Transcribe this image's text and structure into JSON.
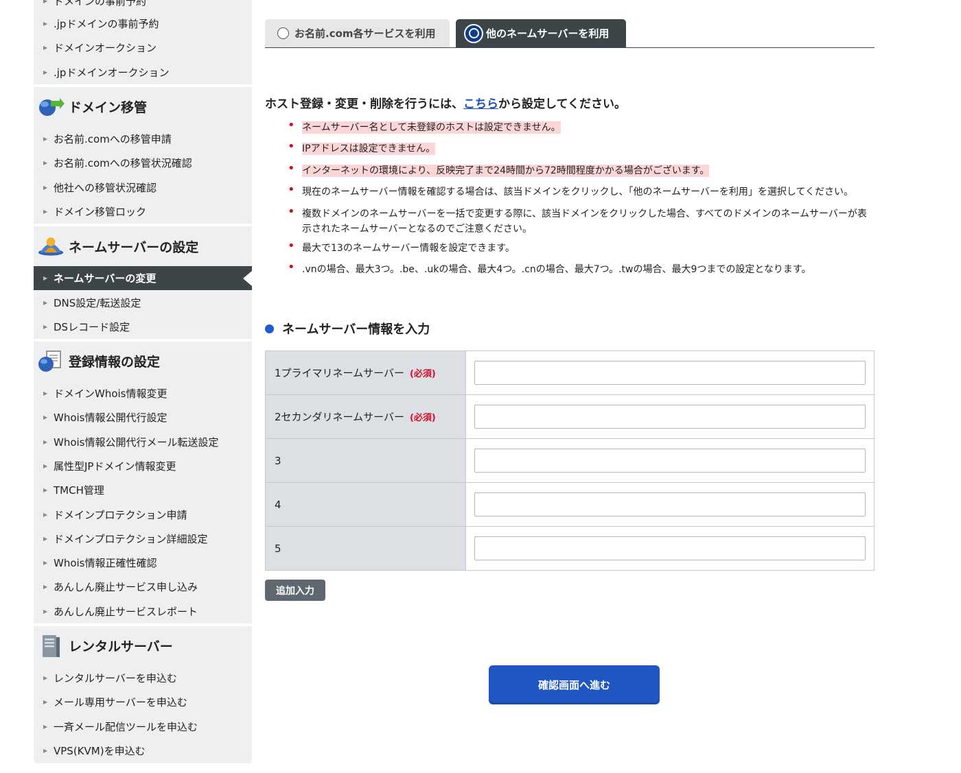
{
  "sidebar": {
    "partial_item": "ドメインの事前予約",
    "group_domain_reservation": [
      ".jpドメインの事前予約",
      "ドメインオークション",
      ".jpドメインオークション"
    ],
    "transfer": {
      "heading": "ドメイン移管",
      "items": [
        "お名前.comへの移管申請",
        "お名前.comへの移管状況確認",
        "他社への移管状況確認",
        "ドメイン移管ロック"
      ]
    },
    "nameserver": {
      "heading": "ネームサーバーの設定",
      "items": [
        "ネームサーバーの変更",
        "DNS設定/転送設定",
        "DSレコード設定"
      ]
    },
    "registration": {
      "heading": "登録情報の設定",
      "items": [
        "ドメインWhois情報変更",
        "Whois情報公開代行設定",
        "Whois情報公開代行メール転送設定",
        "属性型JPドメイン情報変更",
        "TMCH管理",
        "ドメインプロテクション申請",
        "ドメインプロテクション詳細設定",
        "Whois情報正確性確認",
        "あんしん廃止サービス申し込み",
        "あんしん廃止サービスレポート"
      ]
    },
    "rental": {
      "heading": "レンタルサーバー",
      "items": [
        "レンタルサーバーを申込む",
        "メール専用サーバーを申込む",
        "一斉メール配信ツールを申込む",
        "VPS(KVM)を申込む"
      ]
    }
  },
  "tabs": {
    "onamae": "お名前.com各サービスを利用",
    "other": "他のネームサーバーを利用"
  },
  "intro": {
    "before": "ホスト登録・変更・削除を行うには、",
    "link": "こちら",
    "after": "から設定してください。"
  },
  "notes": [
    "ネームサーバー名として未登録のホストは設定できません。",
    "IPアドレスは設定できません。",
    "インターネットの環境により、反映完了まで24時間から72時間程度かかる場合がございます。",
    "現在のネームサーバー情報を確認する場合は、該当ドメインをクリックし、「他のネームサーバーを利用」を選択してください。",
    "複数ドメインのネームサーバーを一括で変更する際に、該当ドメインをクリックした場合、すべてのドメインのネームサーバーが表示されたネームサーバーとなるのでご注意ください。",
    "最大で13のネームサーバー情報を設定できます。",
    ".vnの場合、最大3つ。.be、.ukの場合、最大4つ。.cnの場合、最大7つ。.twの場合、最大9つまでの設定となります。"
  ],
  "form": {
    "section_title": "ネームサーバー情報を入力",
    "required_label": "(必須)",
    "rows": [
      {
        "label": "1プライマリネームサーバー",
        "value": ""
      },
      {
        "label": "2セカンダリネームサーバー",
        "value": ""
      },
      {
        "label": "3",
        "value": ""
      },
      {
        "label": "4",
        "value": ""
      },
      {
        "label": "5",
        "value": ""
      }
    ],
    "add_button": "追加入力",
    "confirm_button": "確認画面へ進む"
  },
  "colors": {
    "sidebar_bg": "#eeeff1",
    "dark": "#3d4549",
    "accent_blue": "#1f56c1",
    "required_red": "#d0112b",
    "highlight_pink": "#fcd6d6"
  }
}
